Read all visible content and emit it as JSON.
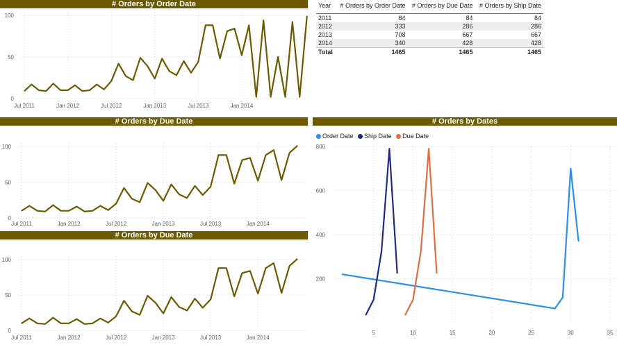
{
  "colors": {
    "title_bar": "#6b5a00",
    "line": "#6b5a00",
    "order_date": "#2c8ef0",
    "ship_date": "#1d2a8a",
    "due_date": "#e46c3e"
  },
  "chart1": {
    "title": "# Orders by Order Date"
  },
  "chart2": {
    "title": "# Orders by Due Date"
  },
  "chart3": {
    "title": "# Orders by Due Date"
  },
  "chart4": {
    "title": "# Orders by Dates"
  },
  "matrix": {
    "headers": [
      "Year",
      "# Orders by Order Date",
      "# Orders by Due Date",
      "# Orders by Ship Date"
    ],
    "rows": [
      [
        "2011",
        "84",
        "84",
        "84"
      ],
      [
        "2012",
        "333",
        "286",
        "286"
      ],
      [
        "2013",
        "708",
        "667",
        "667"
      ],
      [
        "2014",
        "340",
        "428",
        "428"
      ]
    ],
    "total": [
      "Total",
      "1465",
      "1465",
      "1465"
    ]
  },
  "chart_data": [
    {
      "type": "line",
      "title": "# Orders by Order Date",
      "x_ticks": [
        "Jul 2011",
        "Jan 2012",
        "Jul 2012",
        "Jan 2013",
        "Jul 2013",
        "Jan 2014"
      ],
      "ylim": [
        0,
        100
      ],
      "y_ticks": [
        0,
        50,
        100
      ],
      "grid": true,
      "series": [
        {
          "values": [
            9,
            17,
            10,
            9,
            18,
            10,
            10,
            16,
            9,
            10,
            17,
            11,
            21,
            42,
            27,
            22,
            49,
            39,
            24,
            48,
            33,
            28,
            45,
            31,
            44,
            88,
            88,
            48,
            81,
            84,
            52,
            88,
            2,
            94,
            2,
            50,
            2,
            92,
            2,
            99
          ]
        }
      ]
    },
    {
      "type": "line",
      "title": "# Orders by Due Date",
      "x_ticks": [
        "Jul 2011",
        "Jan 2012",
        "Jul 2012",
        "Jan 2013",
        "Jul 2013",
        "Jan 2014"
      ],
      "ylim": [
        0,
        100
      ],
      "y_ticks": [
        0,
        50,
        100
      ],
      "grid": true,
      "series": [
        {
          "values": [
            10,
            17,
            10,
            9,
            18,
            10,
            10,
            16,
            9,
            10,
            17,
            11,
            20,
            42,
            27,
            22,
            49,
            39,
            24,
            47,
            33,
            28,
            45,
            32,
            44,
            88,
            88,
            48,
            81,
            84,
            52,
            88,
            95,
            53,
            91,
            101
          ]
        }
      ]
    },
    {
      "type": "line",
      "title": "# Orders by Due Date",
      "x_ticks": [
        "Jul 2011",
        "Jan 2012",
        "Jul 2012",
        "Jan 2013",
        "Jul 2013",
        "Jan 2014"
      ],
      "ylim": [
        0,
        100
      ],
      "y_ticks": [
        0,
        50,
        100
      ],
      "grid": true,
      "series": [
        {
          "values": [
            10,
            17,
            10,
            9,
            18,
            10,
            10,
            16,
            9,
            10,
            17,
            11,
            20,
            42,
            27,
            22,
            49,
            39,
            24,
            47,
            33,
            28,
            45,
            32,
            44,
            88,
            88,
            48,
            81,
            84,
            52,
            88,
            95,
            53,
            91,
            101
          ]
        }
      ]
    },
    {
      "type": "line",
      "title": "# Orders by Dates",
      "xlim": [
        0,
        35
      ],
      "x_ticks": [
        5,
        10,
        15,
        20,
        25,
        30,
        35
      ],
      "ylim": [
        0,
        800
      ],
      "y_ticks": [
        200,
        400,
        600,
        800
      ],
      "grid": true,
      "legend": "top-left",
      "series": [
        {
          "name": "Order Date",
          "color_key": "order_date",
          "x": [
            1,
            28,
            29,
            30,
            31
          ],
          "y": [
            220,
            65,
            115,
            700,
            370
          ]
        },
        {
          "name": "Ship Date",
          "color_key": "ship_date",
          "x": [
            4,
            5,
            6,
            7,
            8
          ],
          "y": [
            35,
            105,
            325,
            790,
            225
          ]
        },
        {
          "name": "Due Date",
          "color_key": "due_date",
          "x": [
            9,
            10,
            11,
            12,
            13
          ],
          "y": [
            35,
            105,
            325,
            790,
            225
          ]
        }
      ]
    }
  ]
}
